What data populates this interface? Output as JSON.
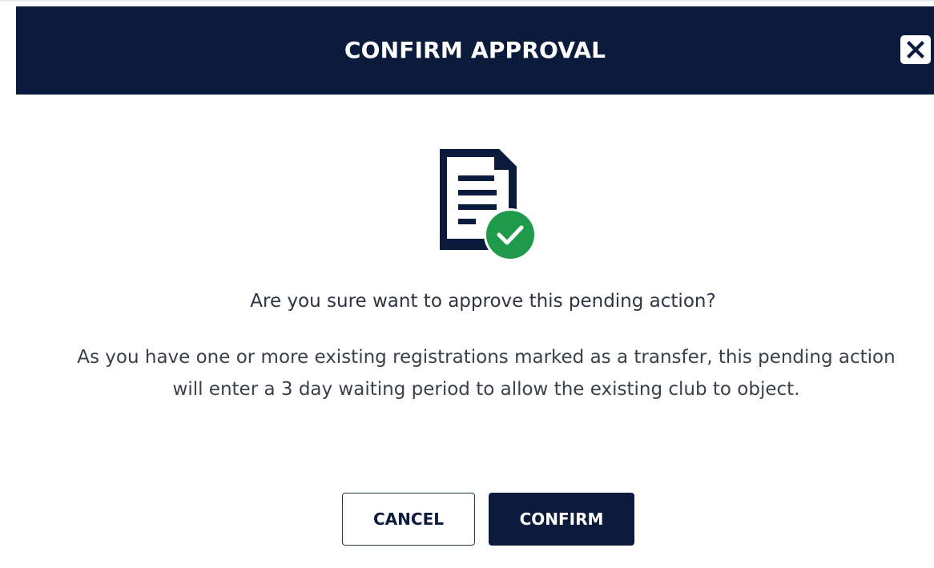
{
  "dialog": {
    "title": "CONFIRM APPROVAL",
    "close_icon": "close-icon",
    "status_icon": "document-approved-icon",
    "question": "Are you sure want to approve this pending action?",
    "description": "As you have one or more existing registrations marked as a transfer, this pending action will enter a 3 day waiting period to allow the existing club to object.",
    "buttons": {
      "cancel_label": "CANCEL",
      "confirm_label": "CONFIRM"
    }
  },
  "colors": {
    "header_bg": "#0b1b3d",
    "primary": "#0b1b3d",
    "success": "#1e9a4a",
    "text": "#3a3f4a"
  }
}
